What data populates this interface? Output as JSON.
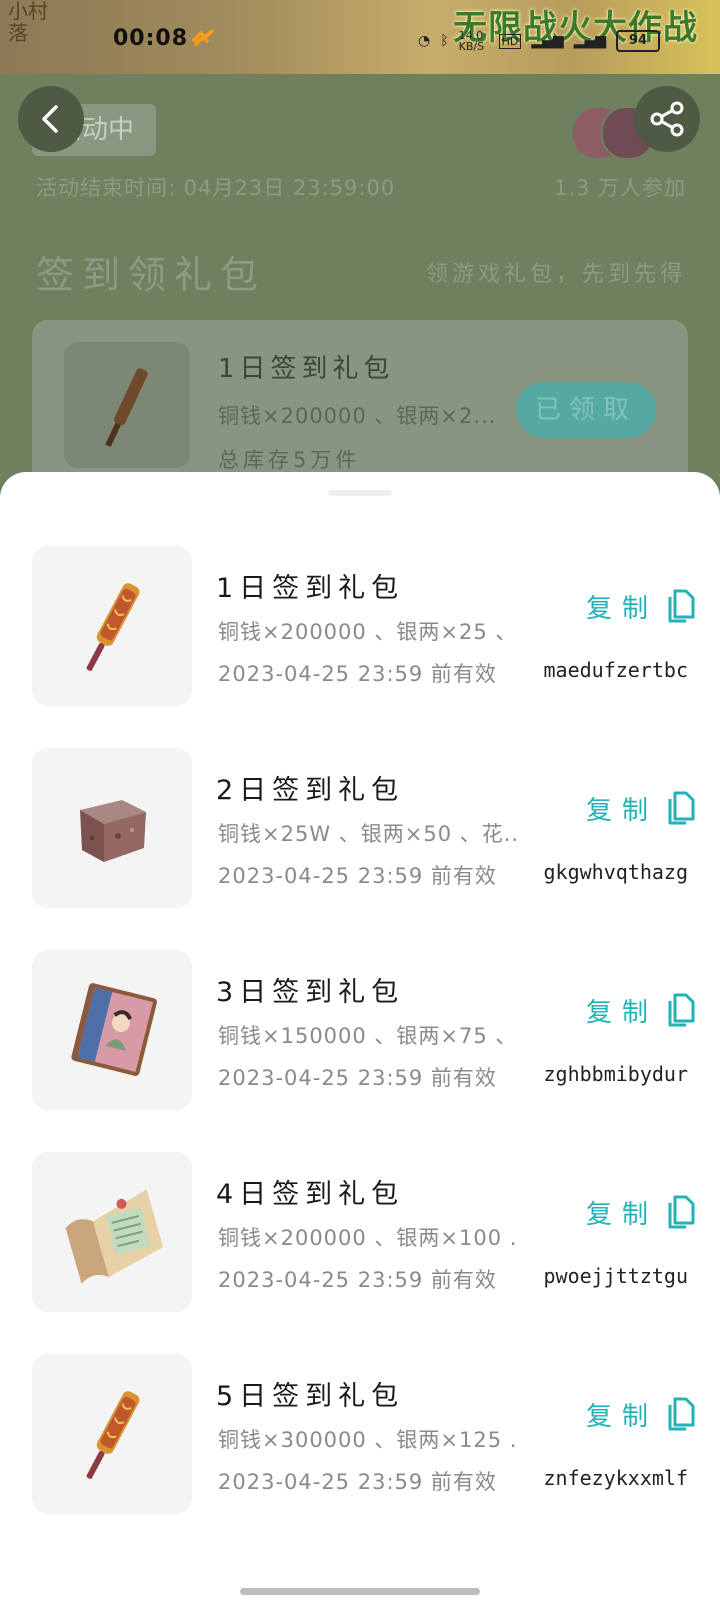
{
  "status_bar": {
    "time": "00:08",
    "net_speed": "14.0 KB/S",
    "hd": "HD",
    "battery": "94"
  },
  "banner": {
    "logo_text": "小村落",
    "title": "无限战火大作战"
  },
  "activity": {
    "status_pill": "活动中",
    "end_time": "活动结束时间: 04月23日 23:59:00",
    "participants": "1.3 万人参加",
    "section_title": "签到领礼包",
    "section_subtitle": "领游戏礼包，先到先得",
    "card": {
      "title": "1日签到礼包",
      "desc": "铜钱×200000 、银两×2...",
      "stock": "总库存5万件",
      "button": "已领取"
    }
  },
  "gifts": [
    {
      "title": "1日签到礼包",
      "desc": "铜钱×200000 、银两×25 、...",
      "valid": "2023-04-25 23:59 前有效",
      "copy_label": "复制",
      "code": "maedufzertbc",
      "icon": "scroll-rod-icon"
    },
    {
      "title": "2日签到礼包",
      "desc": "铜钱×25W 、银两×50 、花...",
      "valid": "2023-04-25 23:59 前有效",
      "copy_label": "复制",
      "code": "gkgwhvqthazg",
      "icon": "stone-block-icon"
    },
    {
      "title": "3日签到礼包",
      "desc": "铜钱×150000 、银两×75 、...",
      "valid": "2023-04-25 23:59 前有效",
      "copy_label": "复制",
      "code": "zghbbmibydur",
      "icon": "portrait-book-icon"
    },
    {
      "title": "4日签到礼包",
      "desc": "铜钱×200000 、银两×100 ...",
      "valid": "2023-04-25 23:59 前有效",
      "copy_label": "复制",
      "code": "pwoejjttztgu",
      "icon": "paper-scroll-icon"
    },
    {
      "title": "5日签到礼包",
      "desc": "铜钱×300000 、银两×125 ...",
      "valid": "2023-04-25 23:59 前有效",
      "copy_label": "复制",
      "code": "znfezykxxmlf",
      "icon": "scroll-rod-icon"
    }
  ],
  "colors": {
    "accent": "#21b3b7",
    "page_bg": "#6b7e5b",
    "text_secondary": "#8a8a8a"
  }
}
